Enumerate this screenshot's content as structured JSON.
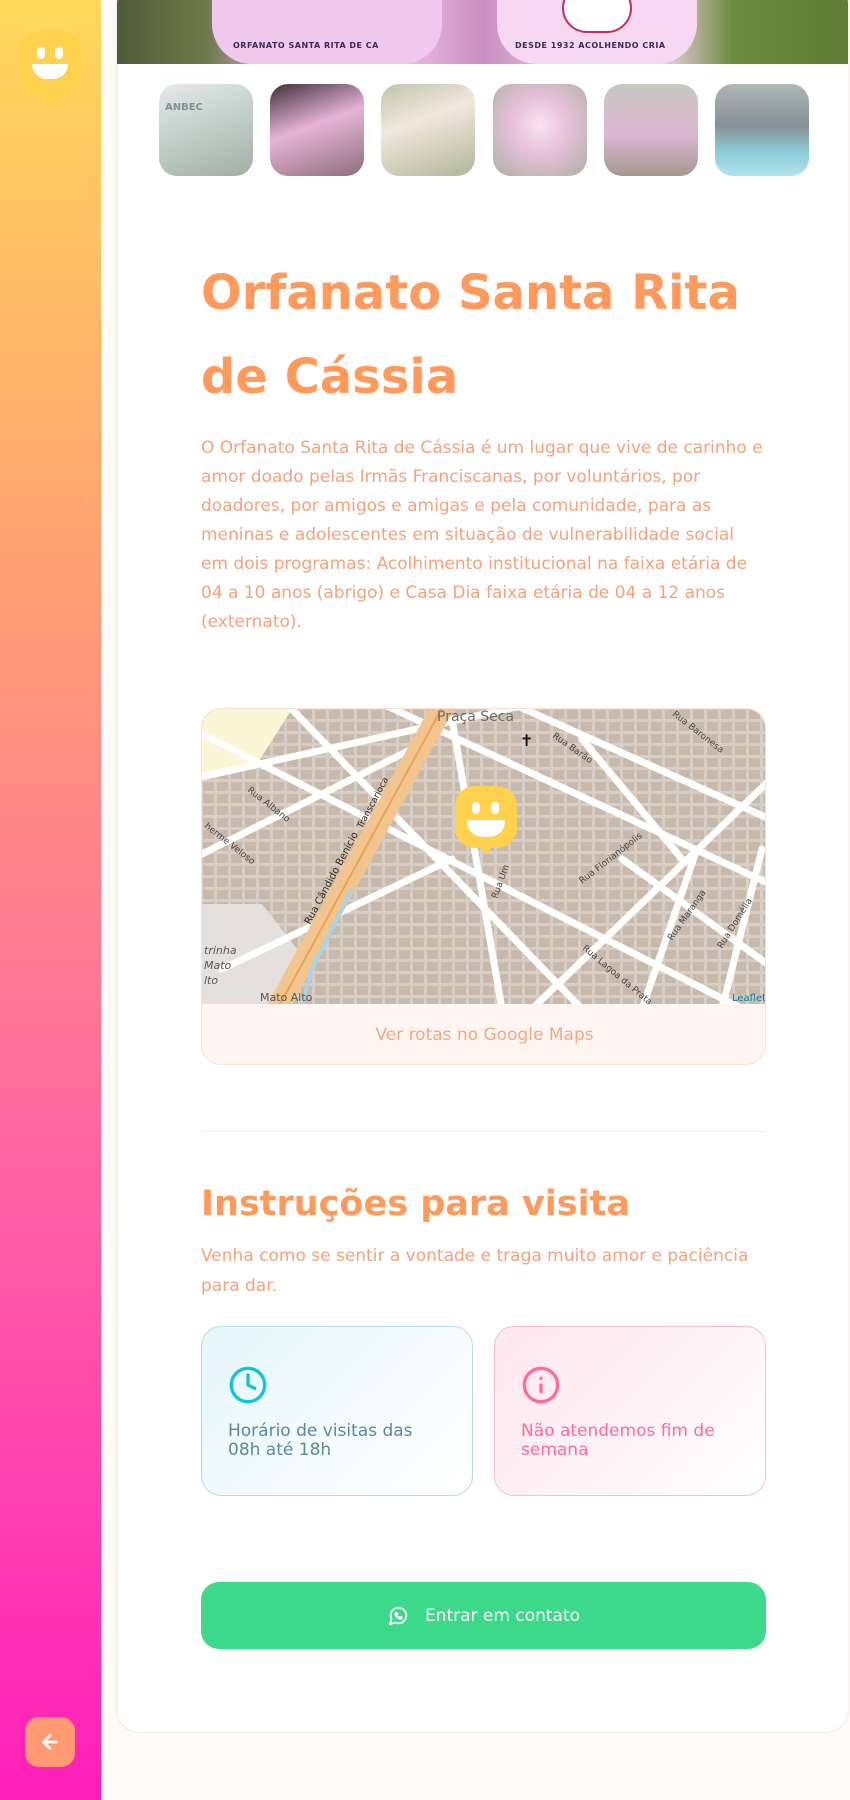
{
  "sidebar": {
    "logo_icon": "happy-face-marker-icon",
    "back_icon": "arrow-left-icon",
    "colors": {
      "top": "#ffd95a",
      "bottom": "#ff1fba",
      "back_button": "#ff9a72"
    }
  },
  "gallery": {
    "hero_texts": [
      "ORFANATO SANTA RITA DE CA",
      "DESDE 1932 ACOLHENDO CRIA",
      "ANBEC"
    ],
    "thumbnails": [
      {
        "alt": "photo-1",
        "active": false
      },
      {
        "alt": "photo-2",
        "active": true
      },
      {
        "alt": "photo-3",
        "active": false
      },
      {
        "alt": "photo-4",
        "active": false
      },
      {
        "alt": "photo-5",
        "active": false
      },
      {
        "alt": "photo-6",
        "active": false
      }
    ]
  },
  "orphanage": {
    "name": "Orfanato Santa Rita de Cássia",
    "about": "O Orfanato Santa Rita de Cássia é um lugar que vive de carinho e amor doado pelas Irmãs Franciscanas, por voluntários, por doadores, por amigos e amigas e pela comunidade, para as meninas e adolescentes em situação de vulnerabilidade social em dois programas: Acolhimento institucional na faixa etária de 04 a 10 anos (abrigo) e Casa Dia faixa etária de 04 a 12 anos (externato)."
  },
  "map": {
    "labels": {
      "praca_seca": "Praça Seca",
      "rua_barao": "Rua Barão",
      "rua_albano": "Rua Albano",
      "rua_candido_benicio": "Rua Cândido Benício",
      "transcarioca": "Transcarioca",
      "rua_florianopolis": "Rua Florianópolis",
      "rua_maranga": "Rua Maranga",
      "rua_baronesa": "Rua Baronesa",
      "guilherme_veloso": "herme Veloso",
      "mato_alto": "Mato Alto",
      "trinha": "trinha",
      "mato": "Mato",
      "lto": "lto",
      "rua_um": "Rua Um",
      "rua_domelia": "Rua Domélia",
      "rua_lagoa_da_prata": "Rua Lagoa da Prata",
      "polis_top": "polis",
      "polis_mid": "polis",
      "rua_florian": "Rua Florian",
      "rua_lamin": "Rua Lamin"
    },
    "attribution": "Leaflet",
    "google_maps_link": "Ver rotas no Google Maps",
    "marker_icon": "happy-face-marker-icon"
  },
  "visit_instructions": {
    "title": "Instruções para visita",
    "text": "Venha como se sentir a vontade e traga muito amor e paciência para dar.",
    "hours": {
      "icon": "clock-icon",
      "text": "Horário de visitas das 08h até 18h",
      "color": "#15c3d6"
    },
    "weekend": {
      "icon": "info-icon",
      "text": "Não atendemos fim de semana",
      "color": "#ff6b9e"
    }
  },
  "contact": {
    "label": "Entrar em contato",
    "icon": "whatsapp-icon",
    "color": "#3dd98b"
  }
}
